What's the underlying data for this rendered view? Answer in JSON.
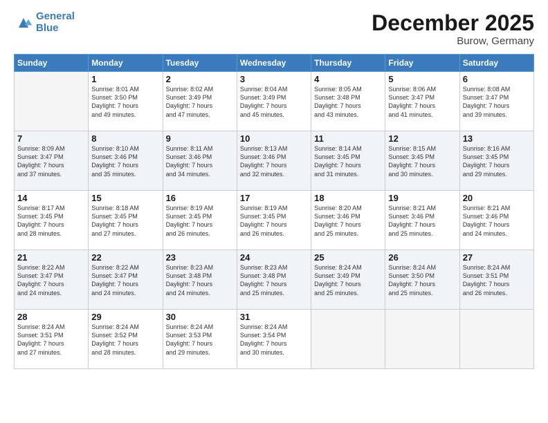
{
  "logo": {
    "line1": "General",
    "line2": "Blue"
  },
  "title": "December 2025",
  "subtitle": "Burow, Germany",
  "days_header": [
    "Sunday",
    "Monday",
    "Tuesday",
    "Wednesday",
    "Thursday",
    "Friday",
    "Saturday"
  ],
  "weeks": [
    {
      "shaded": false,
      "days": [
        {
          "num": "",
          "info": ""
        },
        {
          "num": "1",
          "info": "Sunrise: 8:01 AM\nSunset: 3:50 PM\nDaylight: 7 hours\nand 49 minutes."
        },
        {
          "num": "2",
          "info": "Sunrise: 8:02 AM\nSunset: 3:49 PM\nDaylight: 7 hours\nand 47 minutes."
        },
        {
          "num": "3",
          "info": "Sunrise: 8:04 AM\nSunset: 3:49 PM\nDaylight: 7 hours\nand 45 minutes."
        },
        {
          "num": "4",
          "info": "Sunrise: 8:05 AM\nSunset: 3:48 PM\nDaylight: 7 hours\nand 43 minutes."
        },
        {
          "num": "5",
          "info": "Sunrise: 8:06 AM\nSunset: 3:47 PM\nDaylight: 7 hours\nand 41 minutes."
        },
        {
          "num": "6",
          "info": "Sunrise: 8:08 AM\nSunset: 3:47 PM\nDaylight: 7 hours\nand 39 minutes."
        }
      ]
    },
    {
      "shaded": true,
      "days": [
        {
          "num": "7",
          "info": "Sunrise: 8:09 AM\nSunset: 3:47 PM\nDaylight: 7 hours\nand 37 minutes."
        },
        {
          "num": "8",
          "info": "Sunrise: 8:10 AM\nSunset: 3:46 PM\nDaylight: 7 hours\nand 35 minutes."
        },
        {
          "num": "9",
          "info": "Sunrise: 8:11 AM\nSunset: 3:46 PM\nDaylight: 7 hours\nand 34 minutes."
        },
        {
          "num": "10",
          "info": "Sunrise: 8:13 AM\nSunset: 3:46 PM\nDaylight: 7 hours\nand 32 minutes."
        },
        {
          "num": "11",
          "info": "Sunrise: 8:14 AM\nSunset: 3:45 PM\nDaylight: 7 hours\nand 31 minutes."
        },
        {
          "num": "12",
          "info": "Sunrise: 8:15 AM\nSunset: 3:45 PM\nDaylight: 7 hours\nand 30 minutes."
        },
        {
          "num": "13",
          "info": "Sunrise: 8:16 AM\nSunset: 3:45 PM\nDaylight: 7 hours\nand 29 minutes."
        }
      ]
    },
    {
      "shaded": false,
      "days": [
        {
          "num": "14",
          "info": "Sunrise: 8:17 AM\nSunset: 3:45 PM\nDaylight: 7 hours\nand 28 minutes."
        },
        {
          "num": "15",
          "info": "Sunrise: 8:18 AM\nSunset: 3:45 PM\nDaylight: 7 hours\nand 27 minutes."
        },
        {
          "num": "16",
          "info": "Sunrise: 8:19 AM\nSunset: 3:45 PM\nDaylight: 7 hours\nand 26 minutes."
        },
        {
          "num": "17",
          "info": "Sunrise: 8:19 AM\nSunset: 3:45 PM\nDaylight: 7 hours\nand 26 minutes."
        },
        {
          "num": "18",
          "info": "Sunrise: 8:20 AM\nSunset: 3:46 PM\nDaylight: 7 hours\nand 25 minutes."
        },
        {
          "num": "19",
          "info": "Sunrise: 8:21 AM\nSunset: 3:46 PM\nDaylight: 7 hours\nand 25 minutes."
        },
        {
          "num": "20",
          "info": "Sunrise: 8:21 AM\nSunset: 3:46 PM\nDaylight: 7 hours\nand 24 minutes."
        }
      ]
    },
    {
      "shaded": true,
      "days": [
        {
          "num": "21",
          "info": "Sunrise: 8:22 AM\nSunset: 3:47 PM\nDaylight: 7 hours\nand 24 minutes."
        },
        {
          "num": "22",
          "info": "Sunrise: 8:22 AM\nSunset: 3:47 PM\nDaylight: 7 hours\nand 24 minutes."
        },
        {
          "num": "23",
          "info": "Sunrise: 8:23 AM\nSunset: 3:48 PM\nDaylight: 7 hours\nand 24 minutes."
        },
        {
          "num": "24",
          "info": "Sunrise: 8:23 AM\nSunset: 3:48 PM\nDaylight: 7 hours\nand 25 minutes."
        },
        {
          "num": "25",
          "info": "Sunrise: 8:24 AM\nSunset: 3:49 PM\nDaylight: 7 hours\nand 25 minutes."
        },
        {
          "num": "26",
          "info": "Sunrise: 8:24 AM\nSunset: 3:50 PM\nDaylight: 7 hours\nand 25 minutes."
        },
        {
          "num": "27",
          "info": "Sunrise: 8:24 AM\nSunset: 3:51 PM\nDaylight: 7 hours\nand 26 minutes."
        }
      ]
    },
    {
      "shaded": false,
      "days": [
        {
          "num": "28",
          "info": "Sunrise: 8:24 AM\nSunset: 3:51 PM\nDaylight: 7 hours\nand 27 minutes."
        },
        {
          "num": "29",
          "info": "Sunrise: 8:24 AM\nSunset: 3:52 PM\nDaylight: 7 hours\nand 28 minutes."
        },
        {
          "num": "30",
          "info": "Sunrise: 8:24 AM\nSunset: 3:53 PM\nDaylight: 7 hours\nand 29 minutes."
        },
        {
          "num": "31",
          "info": "Sunrise: 8:24 AM\nSunset: 3:54 PM\nDaylight: 7 hours\nand 30 minutes."
        },
        {
          "num": "",
          "info": ""
        },
        {
          "num": "",
          "info": ""
        },
        {
          "num": "",
          "info": ""
        }
      ]
    }
  ]
}
